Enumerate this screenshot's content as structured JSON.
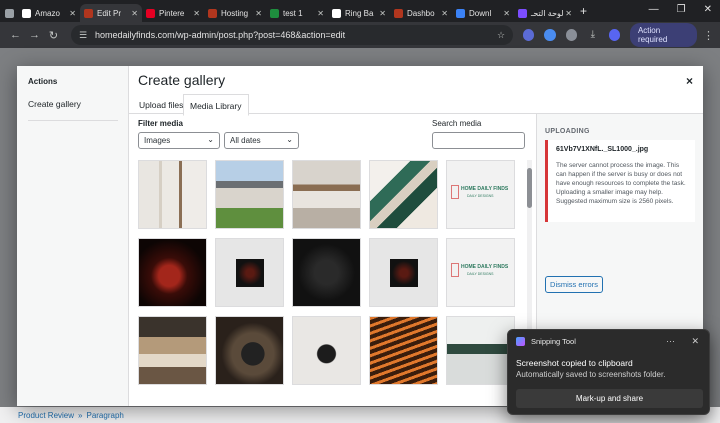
{
  "browser": {
    "tabs": [
      {
        "label": "",
        "color": "#9aa0a6"
      },
      {
        "label": "Amazo",
        "color": "#ffffff"
      },
      {
        "label": "Edit Pr",
        "color": "#b1361e",
        "active": true
      },
      {
        "label": "Pintere",
        "color": "#e60023"
      },
      {
        "label": "Hosting",
        "color": "#b1361e"
      },
      {
        "label": "test 1",
        "color": "#1e8e3e"
      },
      {
        "label": "Ring Ba",
        "color": "#ffffff"
      },
      {
        "label": "Dashbo",
        "color": "#b1361e"
      },
      {
        "label": "Downl",
        "color": "#3b82f6"
      },
      {
        "label": "لوحة التحـ",
        "color": "#7c4dff"
      }
    ],
    "url": "homedailyfinds.com/wp-admin/post.php?post=468&action=edit",
    "action_required": "Action required"
  },
  "page": {
    "breadcrumb_a": "Product Review",
    "breadcrumb_sep": "»",
    "breadcrumb_b": "Paragraph"
  },
  "modal": {
    "sidebar_heading": "Actions",
    "sidebar_item": "Create gallery",
    "title": "Create gallery",
    "close": "×",
    "tab_upload": "Upload files",
    "tab_library": "Media Library",
    "filter_label": "Filter media",
    "filter_type": "Images",
    "filter_date": "All dates",
    "search_label": "Search media"
  },
  "uploading": {
    "heading": "UPLOADING",
    "filename": "61Vb7V1XNfL._SL1000_.jpg",
    "message": "The server cannot process the image. This can happen if the server is busy or does not have enough resources to complete the task. Uploading a smaller image may help. Suggested maximum size is 2560 pixels.",
    "dismiss": "Dismiss errors"
  },
  "toast": {
    "app": "Snipping Tool",
    "title": "Screenshot copied to clipboard",
    "subtitle": "Automatically saved to screenshots folder.",
    "button": "Mark-up and share"
  },
  "thumbs": [
    {
      "kind": "cat-tree"
    },
    {
      "kind": "house"
    },
    {
      "kind": "bedroom"
    },
    {
      "kind": "swatches"
    },
    {
      "kind": "logo"
    },
    {
      "kind": "dark-red"
    },
    {
      "kind": "small-dark"
    },
    {
      "kind": "dark-leaf"
    },
    {
      "kind": "small-dark2"
    },
    {
      "kind": "logo"
    },
    {
      "kind": "living"
    },
    {
      "kind": "echo"
    },
    {
      "kind": "earbuds"
    },
    {
      "kind": "stripes"
    },
    {
      "kind": "gadgets"
    }
  ],
  "logo_text": {
    "line1": "HOME DAILY FINDS",
    "line2": "DAILY DESIGNS"
  }
}
